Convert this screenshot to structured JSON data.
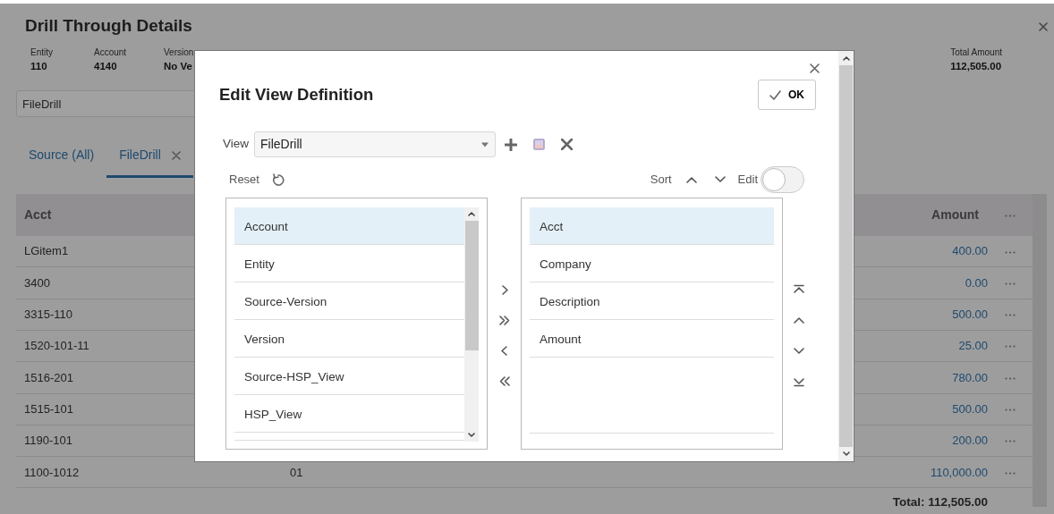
{
  "page": {
    "title": "Drill Through Details"
  },
  "summary": [
    {
      "label": "Entity",
      "value": "110"
    },
    {
      "label": "Account",
      "value": "4140"
    },
    {
      "label": "Version",
      "value": "No Ve"
    }
  ],
  "total_amount": {
    "label": "Total Amount",
    "value": "112,505.00"
  },
  "view_field": {
    "value": "FileDrill"
  },
  "tabs": [
    {
      "label": "Source (All)",
      "selected": false,
      "closable": false
    },
    {
      "label": "FileDrill",
      "selected": true,
      "closable": true
    }
  ],
  "table": {
    "columns": [
      "Acct",
      "Amount"
    ],
    "rows": [
      {
        "acct": "LGitem1",
        "amount": "400.00"
      },
      {
        "acct": "3400",
        "amount": "0.00"
      },
      {
        "acct": "3315-110",
        "amount": "500.00"
      },
      {
        "acct": "1520-101-11",
        "amount": "25.00"
      },
      {
        "acct": "1516-201",
        "amount": "780.00"
      },
      {
        "acct": "1515-101",
        "amount": "500.00"
      },
      {
        "acct": "1190-101",
        "amount": "200.00"
      },
      {
        "acct": "1100-1012",
        "column_2": "01",
        "amount": "110,000.00"
      }
    ],
    "total": "Total: 112,505.00"
  },
  "dialog": {
    "title": "Edit View Definition",
    "ok": "OK",
    "view_label": "View",
    "view_value": "FileDrill",
    "reset": "Reset",
    "sort": "Sort",
    "edit": "Edit",
    "edit_on": false,
    "available": [
      {
        "label": "Account",
        "selected": true
      },
      {
        "label": "Entity",
        "selected": false
      },
      {
        "label": "Source-Version",
        "selected": false
      },
      {
        "label": "Version",
        "selected": false
      },
      {
        "label": "Source-HSP_View",
        "selected": false
      },
      {
        "label": "HSP_View",
        "selected": false
      }
    ],
    "chosen": [
      {
        "label": "Acct",
        "selected": true
      },
      {
        "label": "Company",
        "selected": false
      },
      {
        "label": "Description",
        "selected": false
      },
      {
        "label": "Amount",
        "selected": false
      }
    ]
  }
}
